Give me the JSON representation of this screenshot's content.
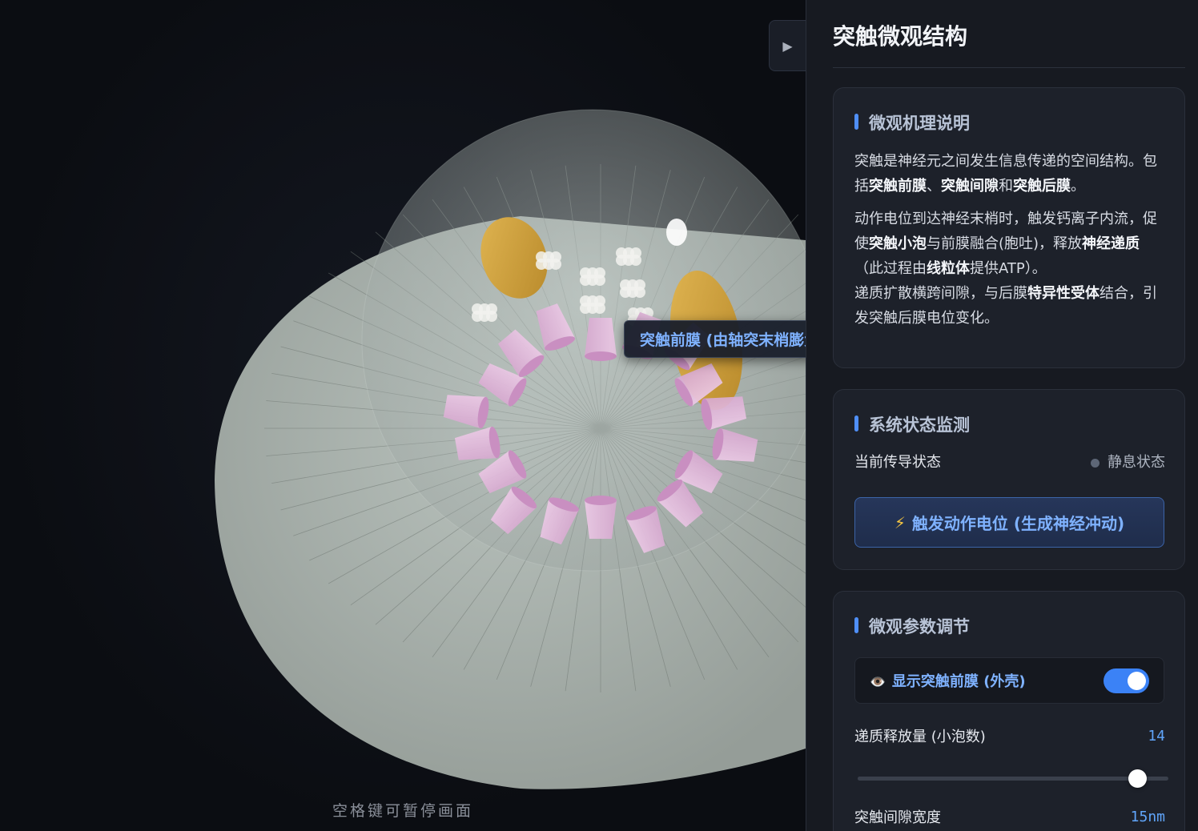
{
  "scene": {
    "hint": "空格键可暂停画面",
    "tooltip": "突触前膜 (由轴突末梢膨大形成)",
    "toggle_icon": "▶"
  },
  "panel": {
    "title": "突触微观结构",
    "mechanism": {
      "heading": "微观机理说明",
      "p1_a": "突触是神经元之间发生信息传递的空间结构。包括",
      "p1_b1": "突触前膜",
      "p1_sep1": "、",
      "p1_b2": "突触间隙",
      "p1_and": "和",
      "p1_b3": "突触后膜",
      "p1_end": "。",
      "p2_a": "动作电位到达神经末梢时，触发钙离子内流，促使",
      "p2_b1": "突触小泡",
      "p2_c": "与前膜融合(胞吐)，释放",
      "p2_b2": "神经递质",
      "p2_d": "（此过程由",
      "p2_b3": "线粒体",
      "p2_e": "提供ATP）。",
      "p3_a": "递质扩散横跨间隙，与后膜",
      "p3_b1": "特异性受体",
      "p3_c": "结合，引发突触后膜电位变化。"
    },
    "monitor": {
      "heading": "系统状态监测",
      "state_label": "当前传导状态",
      "state_value": "静息状态",
      "trigger_icon": "⚡",
      "trigger_label": "触发动作电位 (生成神经冲动)"
    },
    "params": {
      "heading": "微观参数调节",
      "show_icon": "👁️",
      "show_label": "显示突触前膜 (外壳)",
      "show_on": true,
      "release_label": "递质释放量 (小泡数)",
      "release_value": "14",
      "release_fraction": 0.9,
      "gap_label": "突触间隙宽度",
      "gap_value": "15nm"
    }
  }
}
